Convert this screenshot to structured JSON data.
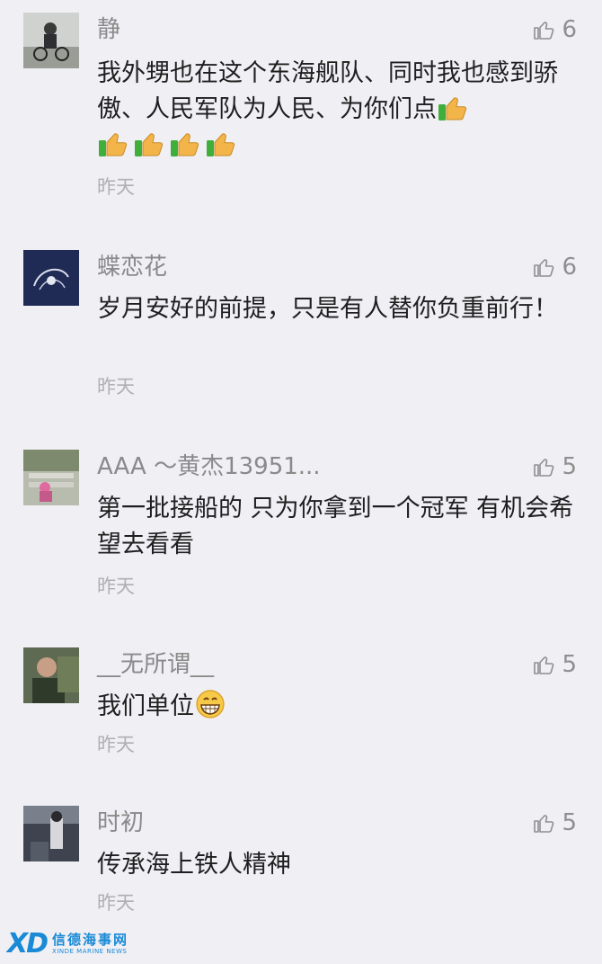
{
  "comments": [
    {
      "nickname": "静",
      "likes": "6",
      "content": "我外甥也在这个东海舰队、同时我也感到骄傲、人民军队为人民、为你们点",
      "emoji_after": [
        "thumbs-up",
        "thumbs-up",
        "thumbs-up",
        "thumbs-up",
        "thumbs-up"
      ],
      "time": "昨天",
      "avatar_color": "#8a8f86"
    },
    {
      "nickname": "蝶恋花",
      "likes": "6",
      "content": "岁月安好的前提，只是有人替你负重前行！",
      "time": "昨天",
      "avatar_color": "#23305a"
    },
    {
      "nickname": "AAA ～黄杰13951...",
      "likes": "5",
      "content": "第一批接船的 只为你拿到一个冠军 有机会希望去看看",
      "time": "昨天",
      "avatar_color": "#9aa08c"
    },
    {
      "nickname": "__无所谓__",
      "likes": "5",
      "content": "我们单位",
      "emoji_after": [
        "grin"
      ],
      "time": "昨天",
      "avatar_color": "#4f5a45"
    },
    {
      "nickname": "时初",
      "likes": "5",
      "content": "传承海上铁人精神",
      "time": "昨天",
      "avatar_color": "#4a4f5e"
    }
  ],
  "watermark": {
    "logo": "XD",
    "name_cn": "信德海事网",
    "name_en": "XINDE MARINE NEWS"
  }
}
